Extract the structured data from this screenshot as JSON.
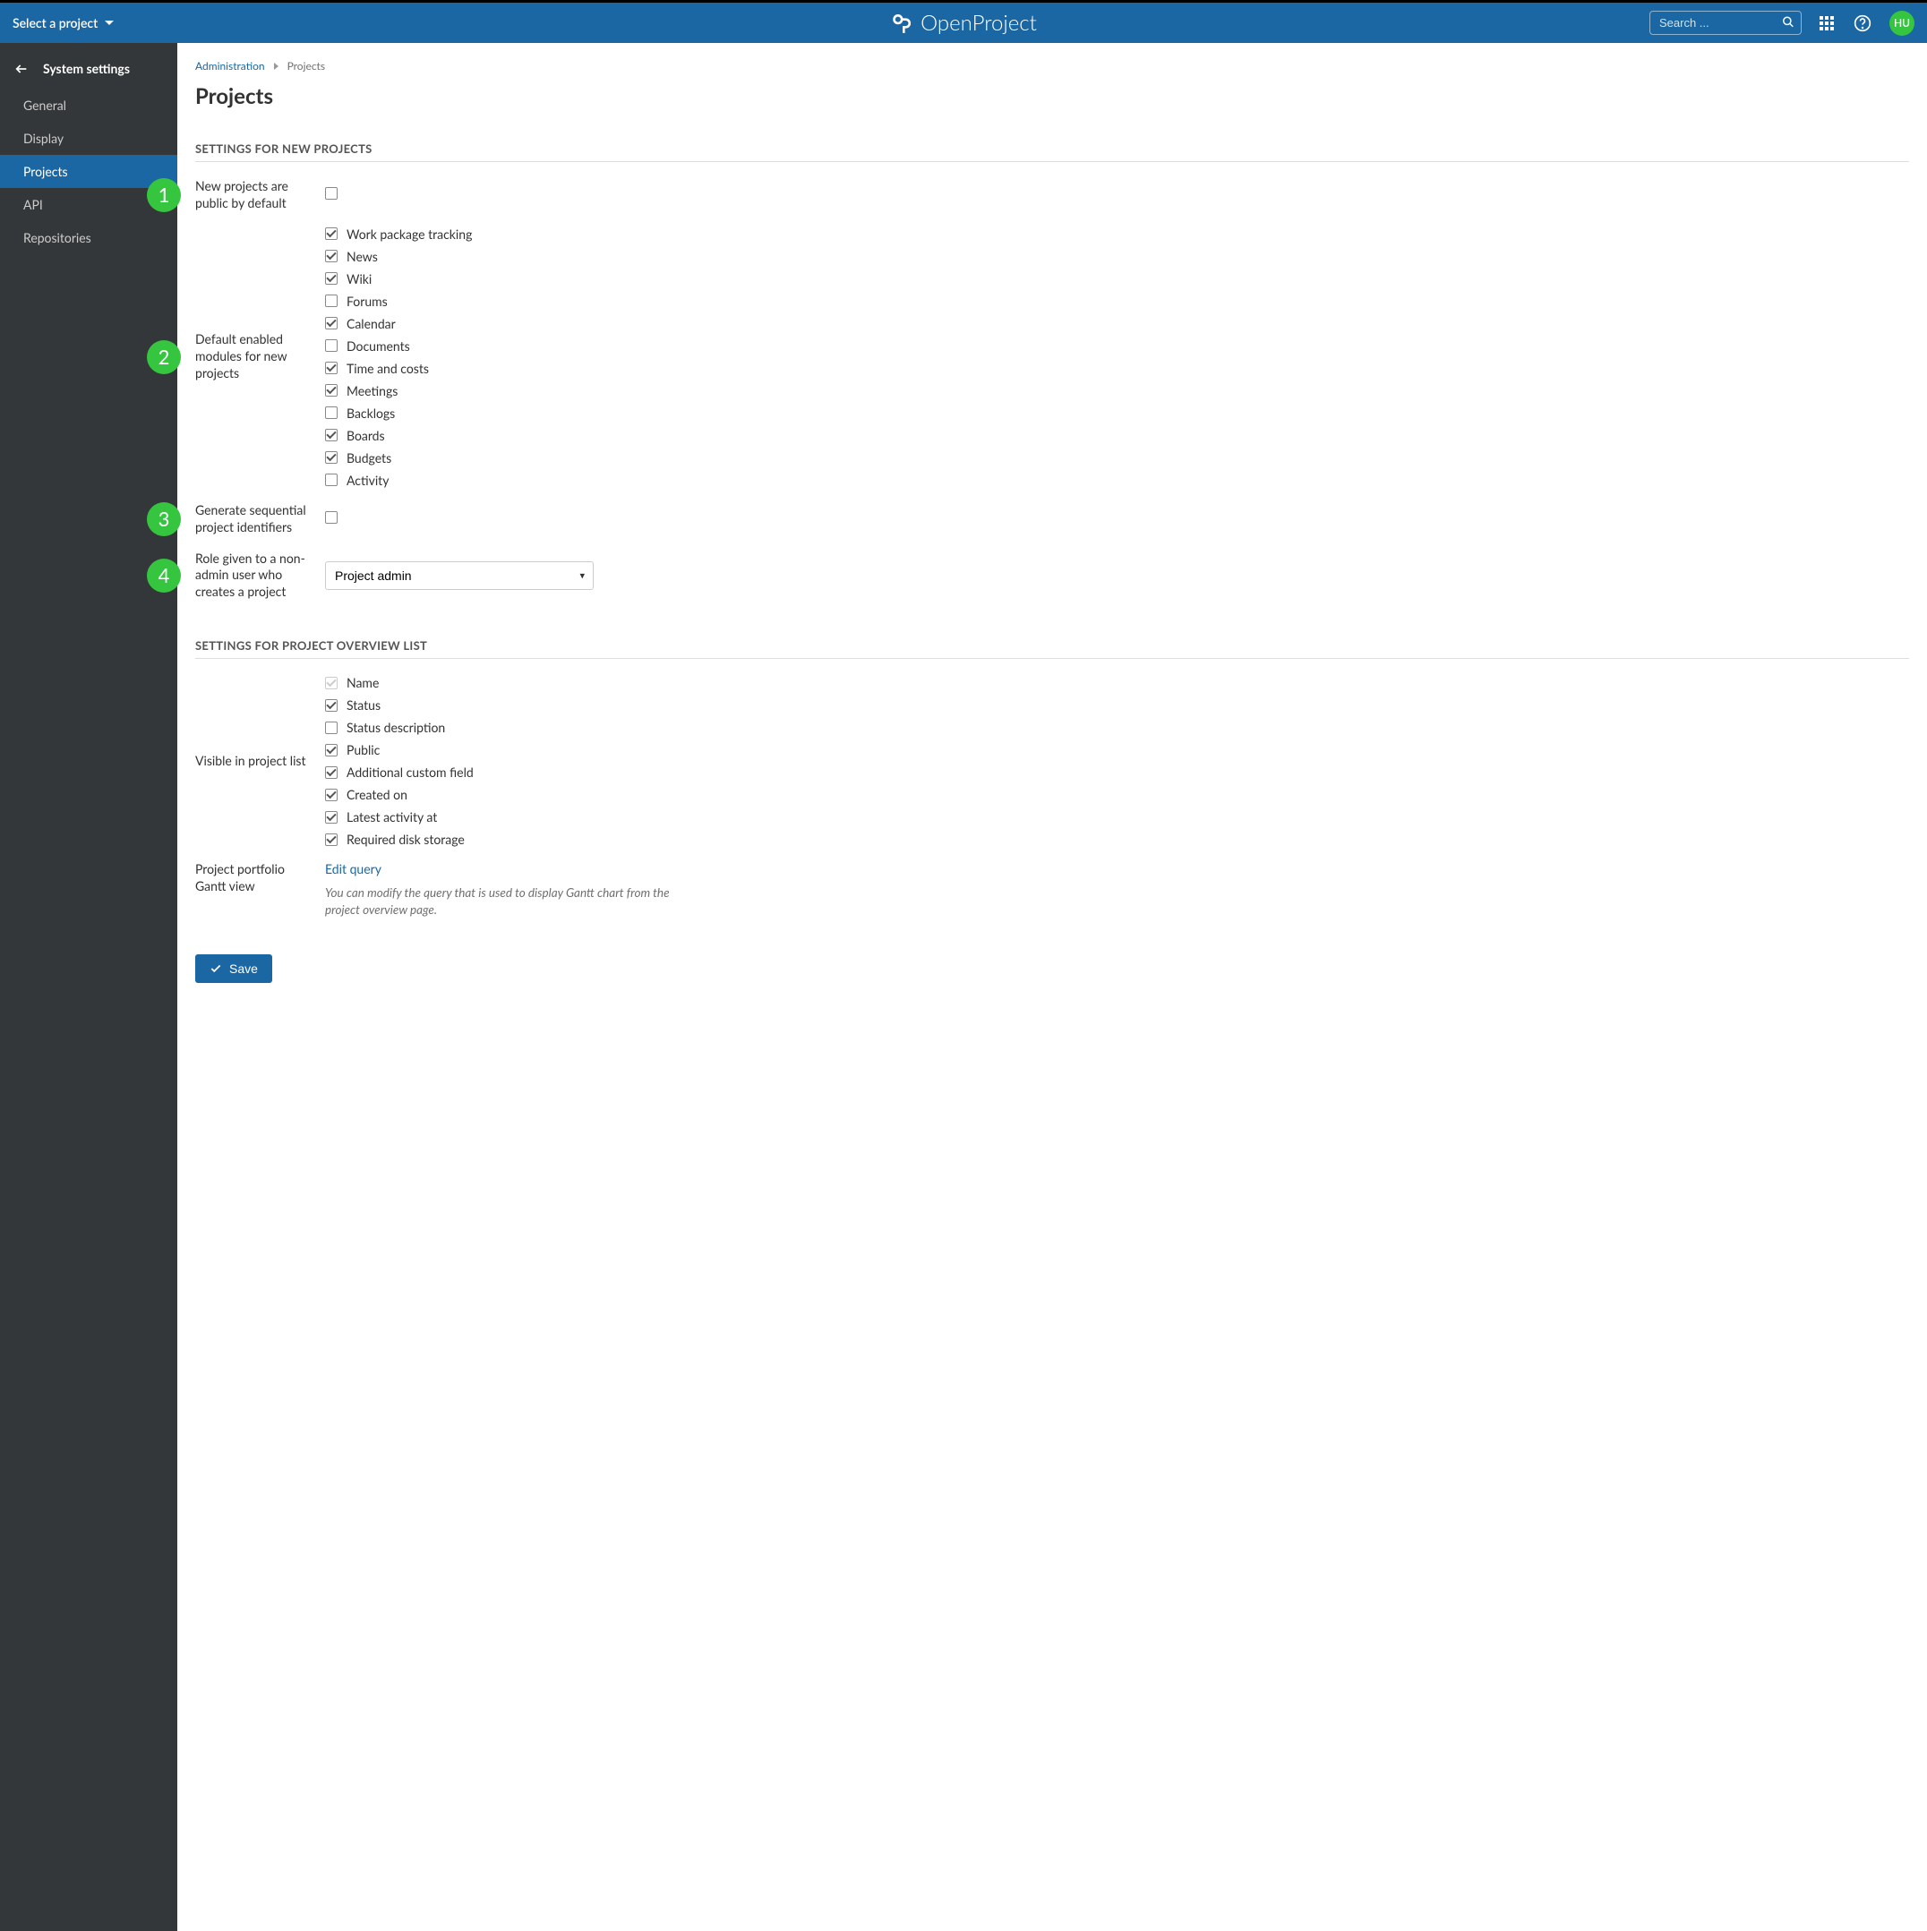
{
  "topbar": {
    "project_selector": "Select a project",
    "brand": "OpenProject",
    "search_placeholder": "Search ...",
    "avatar_initials": "HU"
  },
  "sidebar": {
    "title": "System settings",
    "items": [
      {
        "label": "General",
        "active": false
      },
      {
        "label": "Display",
        "active": false
      },
      {
        "label": "Projects",
        "active": true
      },
      {
        "label": "API",
        "active": false
      },
      {
        "label": "Repositories",
        "active": false
      }
    ]
  },
  "breadcrumb": {
    "root": "Administration",
    "current": "Projects"
  },
  "page_title": "Projects",
  "section1": {
    "header": "SETTINGS FOR NEW PROJECTS",
    "public_label": "New projects are public by default",
    "public_checked": false,
    "modules_label": "Default enabled modules for new projects",
    "modules": [
      {
        "label": "Work package tracking",
        "checked": true
      },
      {
        "label": "News",
        "checked": true
      },
      {
        "label": "Wiki",
        "checked": true
      },
      {
        "label": "Forums",
        "checked": false
      },
      {
        "label": "Calendar",
        "checked": true
      },
      {
        "label": "Documents",
        "checked": false
      },
      {
        "label": "Time and costs",
        "checked": true
      },
      {
        "label": "Meetings",
        "checked": true
      },
      {
        "label": "Backlogs",
        "checked": false
      },
      {
        "label": "Boards",
        "checked": true
      },
      {
        "label": "Budgets",
        "checked": true
      },
      {
        "label": "Activity",
        "checked": false
      }
    ],
    "sequential_label": "Generate sequential project identifiers",
    "sequential_checked": false,
    "role_label": "Role given to a non-admin user who creates a project",
    "role_value": "Project admin"
  },
  "section2": {
    "header": "SETTINGS FOR PROJECT OVERVIEW LIST",
    "visible_label": "Visible in project list",
    "columns": [
      {
        "label": "Name",
        "checked": true,
        "disabled": true
      },
      {
        "label": "Status",
        "checked": true
      },
      {
        "label": "Status description",
        "checked": false
      },
      {
        "label": "Public",
        "checked": true
      },
      {
        "label": "Additional custom field",
        "checked": true
      },
      {
        "label": "Created on",
        "checked": true
      },
      {
        "label": "Latest activity at",
        "checked": true
      },
      {
        "label": "Required disk storage",
        "checked": true
      }
    ],
    "gantt_label": "Project portfolio Gantt view",
    "gantt_link": "Edit query",
    "gantt_help": "You can modify the query that is used to display Gantt chart from the project overview page."
  },
  "save_label": "Save",
  "bubbles": [
    "1",
    "2",
    "3",
    "4"
  ]
}
